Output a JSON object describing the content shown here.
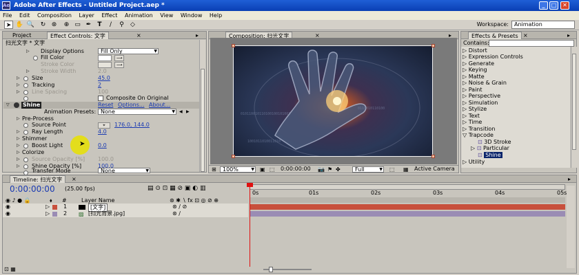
{
  "window": {
    "title": "Adobe After Effects - Untitled Project.aep *",
    "min": "_",
    "max": "□",
    "close": "✕"
  },
  "menu": [
    "File",
    "Edit",
    "Composition",
    "Layer",
    "Effect",
    "Animation",
    "View",
    "Window",
    "Help"
  ],
  "toolbar": {
    "workspace_label": "Workspace:",
    "workspace_value": "Animation"
  },
  "left_panel": {
    "tab_project": "Project",
    "tab_effect_controls": "Effect Controls: 文字",
    "header": "扫光文字 * 文字",
    "rows": [
      {
        "label": "Display Options",
        "value": "Fill Only"
      },
      {
        "label": "Fill Color"
      },
      {
        "label": "Stroke Color"
      },
      {
        "label": "Stroke Width",
        "value": "2.0"
      },
      {
        "label": "Size",
        "value": "45.0"
      },
      {
        "label": "Tracking",
        "value": "2"
      },
      {
        "label": "Line Spacing",
        "value": "100"
      },
      {
        "label": "Composite On Original"
      },
      {
        "label": "Shine"
      },
      {
        "label": "Animation Presets:",
        "value": "None"
      },
      {
        "label": "Pre-Process"
      },
      {
        "label": "Source Point",
        "value": "176.0, 144.0"
      },
      {
        "label": "Ray Length",
        "value": "4.0"
      },
      {
        "label": "Shimmer"
      },
      {
        "label": "Boost Light",
        "value": "0.0"
      },
      {
        "label": "Colorize"
      },
      {
        "label": "Source Opacity [%]",
        "value": "100.0"
      },
      {
        "label": "Shine Opacity [%]",
        "value": "100.0"
      },
      {
        "label": "Transfer Mode",
        "value": "None"
      }
    ],
    "shine_links": {
      "reset": "Reset",
      "options": "Options...",
      "about": "About..."
    }
  },
  "composition": {
    "tab": "Composition: 扫光文字",
    "zoom": "100%",
    "timecode": "0:00:00:00",
    "resolution": "Full",
    "camera": "Active Camera"
  },
  "effects_panel": {
    "tab": "Effects & Presets",
    "contains_label": "Contains:",
    "items": [
      "Distort",
      "Expression Controls",
      "Generate",
      "Keying",
      "Matte",
      "Noise & Grain",
      "Paint",
      "Perspective",
      "Simulation",
      "Stylize",
      "Text",
      "Time",
      "Transition",
      "Trapcode",
      "3D Stroke",
      "Particular",
      "Shine",
      "Utility"
    ]
  },
  "timeline": {
    "tab": "Timeline: 扫光文字",
    "timecode": "0:00:00:00",
    "fps": "(25.00 fps)",
    "col_num": "#",
    "col_layer_name": "Layer Name",
    "ruler": [
      "0s",
      "01s",
      "02s",
      "03s",
      "04s",
      "05s"
    ],
    "layers": [
      {
        "num": "1",
        "name": "[文字]",
        "color": "#c8503c"
      },
      {
        "num": "2",
        "name": "[扫光背景.jpg]",
        "color": "#9a8cb4"
      }
    ]
  }
}
